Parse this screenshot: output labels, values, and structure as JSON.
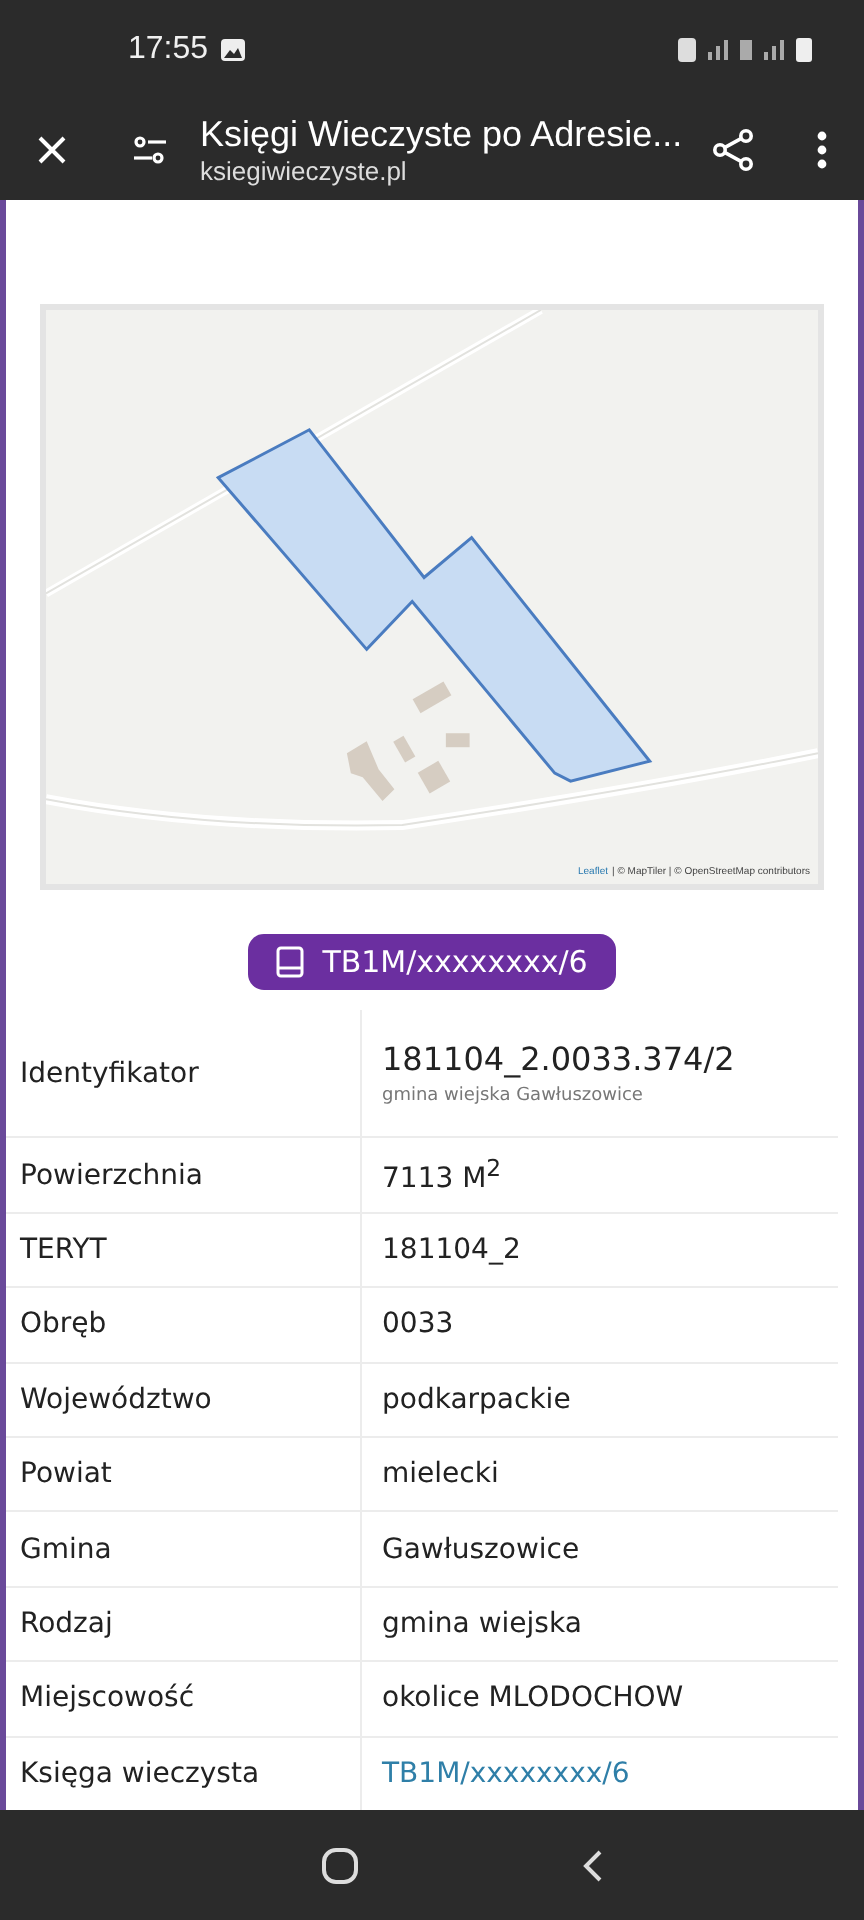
{
  "status_bar": {
    "time": "17:55"
  },
  "toolbar": {
    "title": "Księgi Wieczyste po Adresie...",
    "url": "ksiegiwieczyste.pl"
  },
  "map": {
    "kind": "picture",
    "attribution": [
      {
        "text": "Leaflet",
        "link": true
      },
      {
        "text": "| © MapTiler | © OpenStreetMap contributors",
        "link": false
      }
    ]
  },
  "book_button": {
    "label": "TB1M/xxxxxxxx/6"
  },
  "table": {
    "rows": [
      {
        "label": "Identyfikator",
        "value": "181104_2.0033.374/2",
        "note": "gmina wiejska Gawłuszowice",
        "kind": "text"
      },
      {
        "label": "Powierzchnia",
        "value": "7113 M$^{2}$",
        "kind": "text"
      },
      {
        "label": "TERYT",
        "value": "181104_2",
        "kind": "text"
      },
      {
        "label": "Obręb",
        "value": "0033",
        "kind": "text"
      },
      {
        "label": "Województwo",
        "value": "podkarpackie",
        "kind": "text"
      },
      {
        "label": "Powiat",
        "value": "mielecki",
        "kind": "text"
      },
      {
        "label": "Gmina",
        "value": "Gawłuszowice",
        "kind": "text"
      },
      {
        "label": "Rodzaj",
        "value": "gmina wiejska",
        "kind": "text"
      },
      {
        "label": "Miejscowość",
        "value": "okolice MLODOCHOW",
        "kind": "text"
      },
      {
        "label": "Księga wieczysta",
        "value": "TB1M/xxxxxxxx/6",
        "kind": "link"
      }
    ]
  }
}
